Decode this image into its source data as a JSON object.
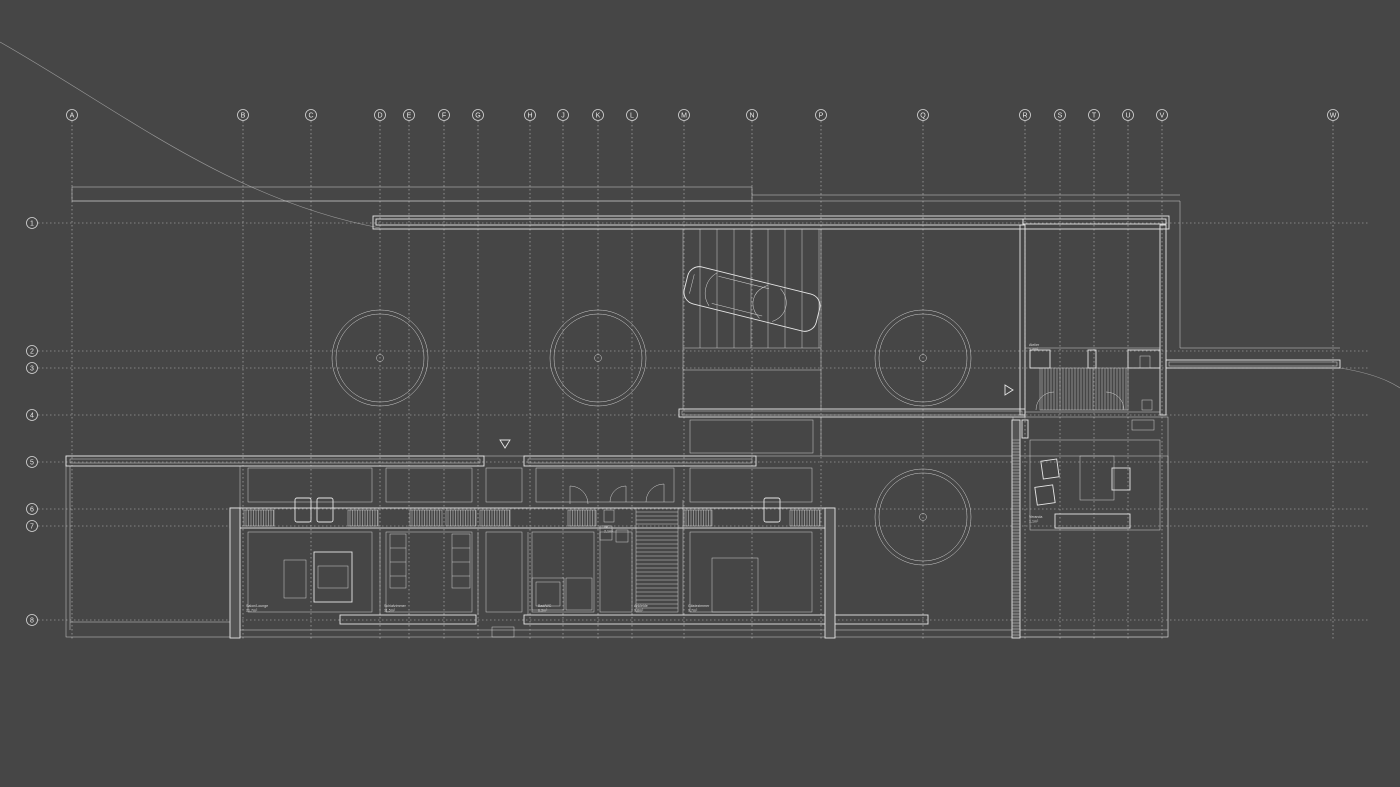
{
  "plan": {
    "column_axes": [
      "A",
      "B",
      "C",
      "D",
      "E",
      "F",
      "G",
      "H",
      "J",
      "K",
      "L",
      "M",
      "N",
      "P",
      "Q",
      "R",
      "S",
      "T",
      "U",
      "V",
      "W"
    ],
    "row_axes": [
      "1",
      "2",
      "3",
      "4",
      "5",
      "6",
      "7",
      "8"
    ],
    "room_labels": [
      {
        "name": "Salon/Lounge",
        "area": "21,7m²"
      },
      {
        "name": "Schlafzimmer",
        "area": "11,5m²"
      },
      {
        "name": "Bad/WC",
        "area": "6,3m²"
      },
      {
        "name": "Ankleide",
        "area": "9,8m²"
      },
      {
        "name": "Gästezimmer",
        "area": "9,7m²"
      },
      {
        "name": "WC",
        "area": "2,1m²"
      },
      {
        "name": "Atelier",
        "area": "1,4m²"
      },
      {
        "name": "Veranda",
        "area": "1,1m²"
      }
    ]
  }
}
